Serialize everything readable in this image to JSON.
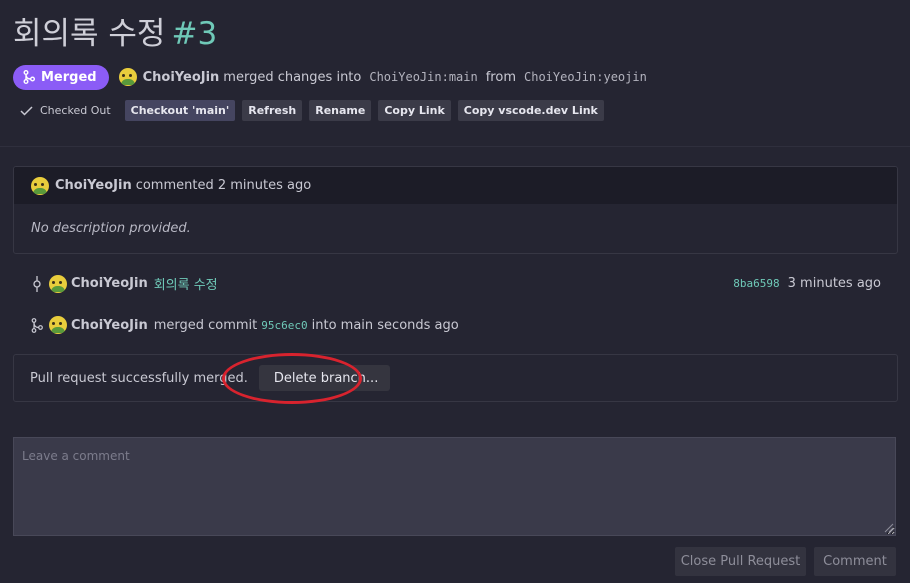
{
  "title": {
    "text": "회의록 수정",
    "number": "#3"
  },
  "status": {
    "badge": "Merged",
    "author": "ChoiYeoJin",
    "action": "merged changes into",
    "base": "ChoiYeoJin:main",
    "from_word": "from",
    "head": "ChoiYeoJin:yeojin",
    "badge_color": "#8b5cf6"
  },
  "actions": {
    "checked_out": "Checked Out",
    "buttons": [
      "Checkout 'main'",
      "Refresh",
      "Rename",
      "Copy Link",
      "Copy vscode.dev Link"
    ]
  },
  "comment": {
    "author": "ChoiYeoJin",
    "meta": "commented 2 minutes ago",
    "body": "No description provided."
  },
  "timeline": [
    {
      "type": "commit",
      "icon": "git-commit-icon",
      "author": "ChoiYeoJin",
      "message": "회의록 수정",
      "hash": "8ba6598",
      "time": "3 minutes ago"
    },
    {
      "type": "merge",
      "icon": "git-merge-icon",
      "author": "ChoiYeoJin",
      "text_before": "merged commit",
      "hash": "95c6ec0",
      "text_after": "into main seconds ago"
    }
  ],
  "merged_box": {
    "message": "Pull request successfully merged.",
    "delete_button": "Delete branch..."
  },
  "new_comment": {
    "placeholder": "Leave a comment",
    "close_button": "Close Pull Request",
    "submit_button": "Comment"
  },
  "colors": {
    "background": "#252532",
    "accent": "#6fc9b8",
    "highlight": "#d8232e"
  }
}
